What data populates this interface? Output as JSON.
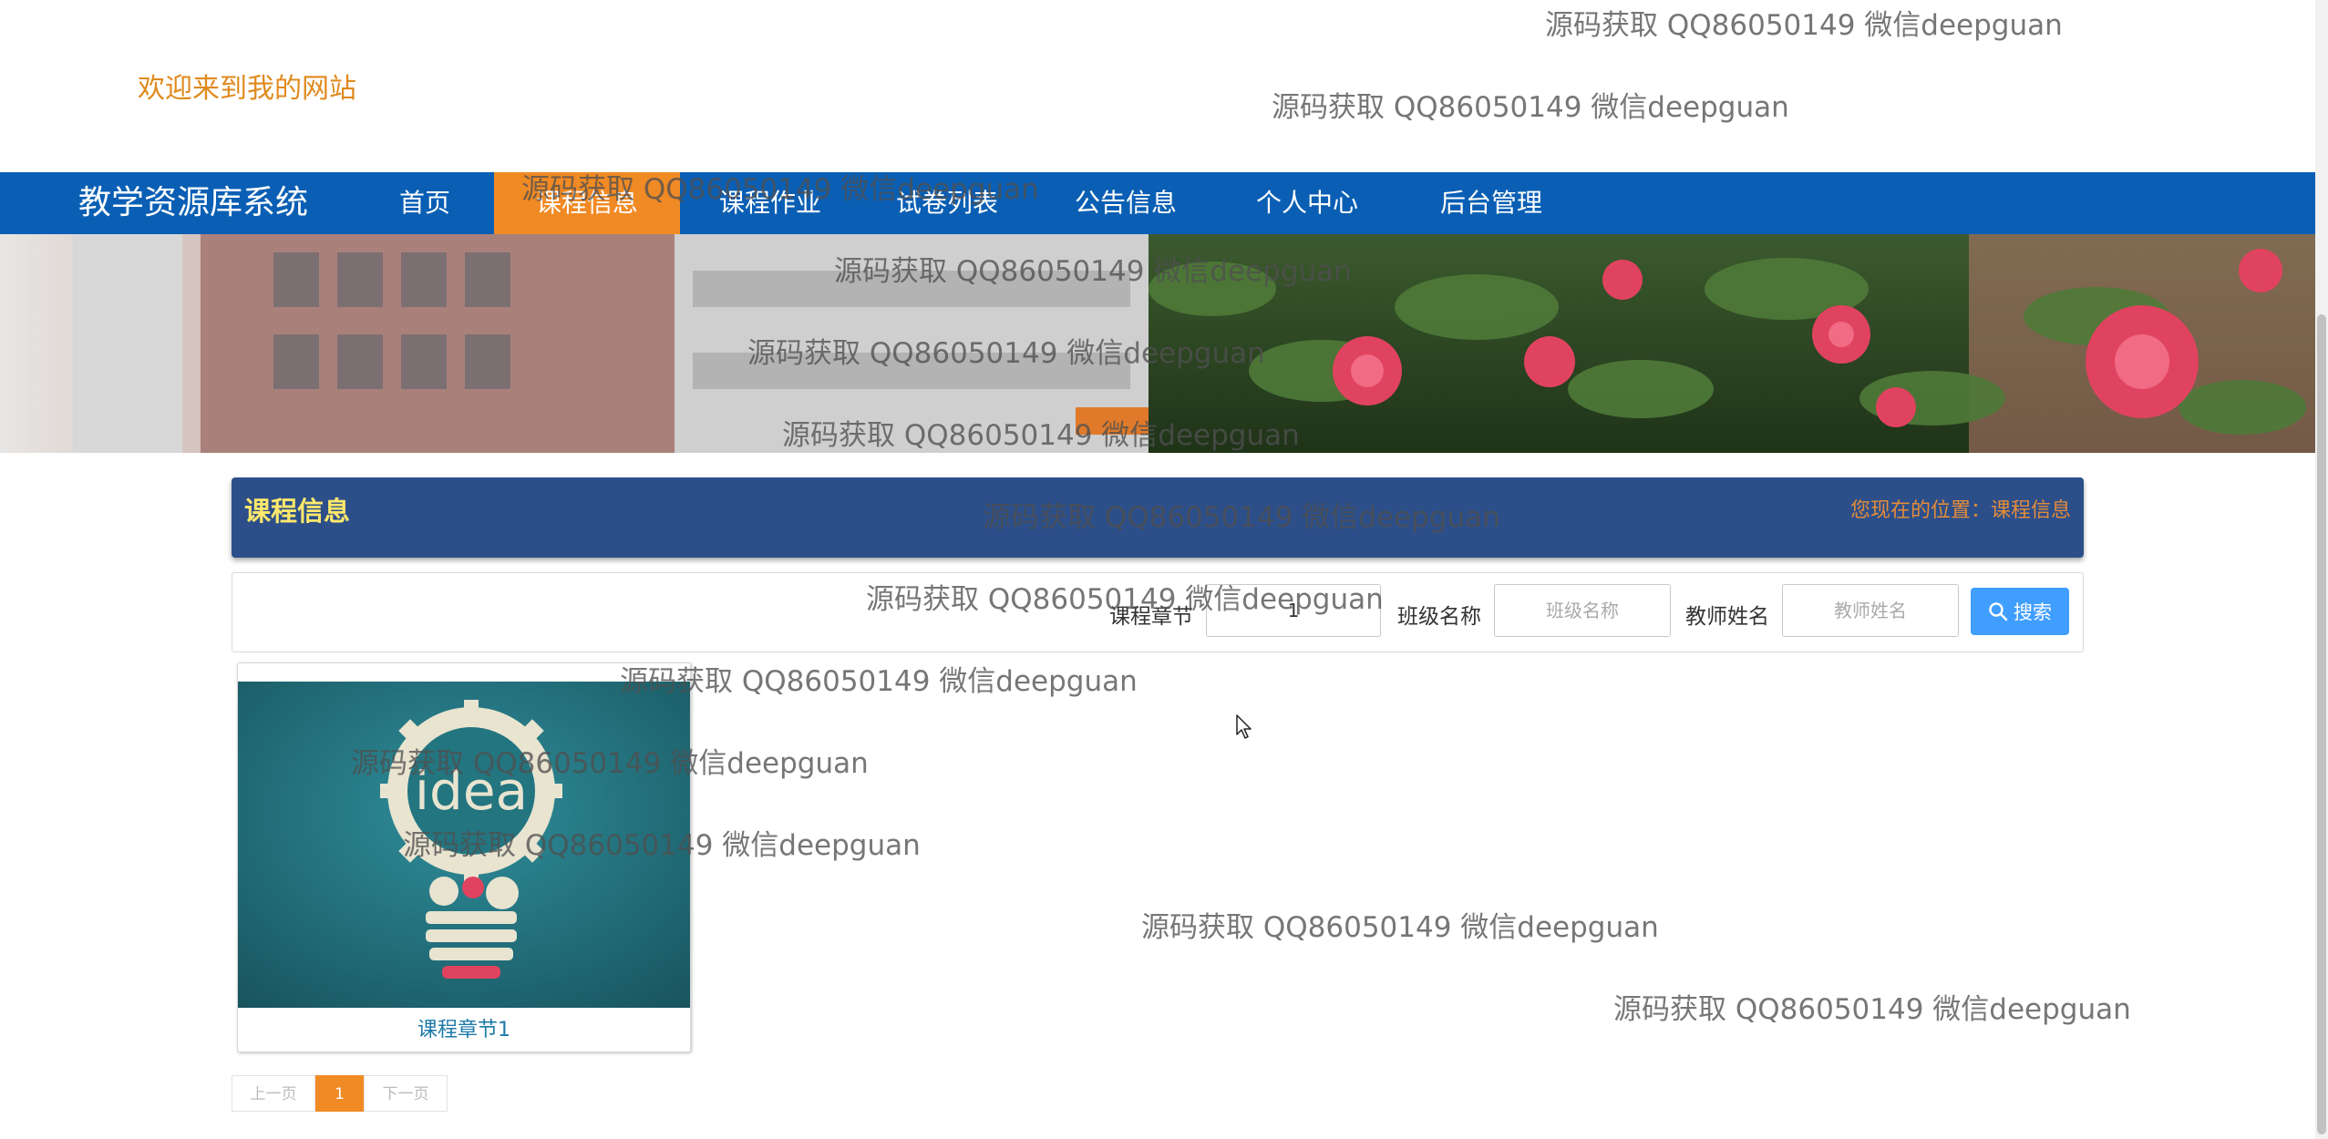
{
  "header": {
    "welcome": "欢迎来到我的网站"
  },
  "nav": {
    "brand": "教学资源库系统",
    "items": [
      {
        "label": "首页"
      },
      {
        "label": "课程信息"
      },
      {
        "label": "课程作业"
      },
      {
        "label": "试卷列表"
      },
      {
        "label": "公告信息"
      },
      {
        "label": "个人中心"
      },
      {
        "label": "后台管理"
      }
    ],
    "active_color": "#f08a24",
    "bar_color": "#0a5fb4"
  },
  "section": {
    "title": "课程信息",
    "position_label": "您现在的位置：课程信息"
  },
  "search": {
    "fields": [
      {
        "label": "课程章节",
        "value": "1",
        "placeholder": ""
      },
      {
        "label": "班级名称",
        "value": "",
        "placeholder": "班级名称"
      },
      {
        "label": "教师姓名",
        "value": "",
        "placeholder": "教师姓名"
      }
    ],
    "button_label": "搜索",
    "button_icon": "search-icon"
  },
  "cards": [
    {
      "caption": "课程章节1",
      "image_icon": "idea-lightbulb-image"
    }
  ],
  "pagination": {
    "prev": "上一页",
    "current": "1",
    "next": "下一页"
  },
  "watermark": {
    "text": "源码获取 QQ86050149 微信deepguan"
  }
}
